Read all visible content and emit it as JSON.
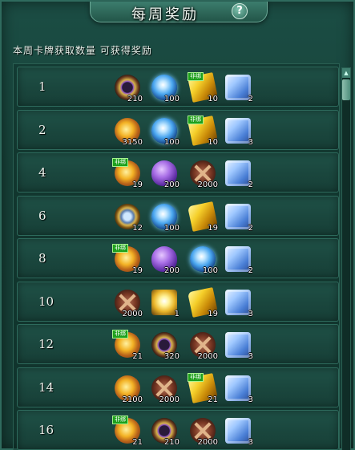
{
  "header": {
    "title": "每周奖励",
    "help_label": "?"
  },
  "subtitle": "本周卡牌获取数量  可获得奖励",
  "rows": [
    {
      "level": "1",
      "items": [
        {
          "name": "purple-ring-icon",
          "cls": "ico-ring",
          "qty": "210",
          "tag": ""
        },
        {
          "name": "blue-orb-icon",
          "cls": "ico-orb",
          "qty": "100",
          "tag": ""
        },
        {
          "name": "gold-crystal-icon",
          "cls": "ico-crystal",
          "qty": "10",
          "tag": "非绑"
        },
        {
          "name": "gift-box-icon",
          "cls": "ico-gift",
          "qty": "2",
          "tag": ""
        }
      ]
    },
    {
      "level": "2",
      "items": [
        {
          "name": "gold-token-icon",
          "cls": "ico-token",
          "qty": "3150",
          "tag": ""
        },
        {
          "name": "blue-orb-icon",
          "cls": "ico-orb",
          "qty": "100",
          "tag": ""
        },
        {
          "name": "gold-crystal-icon",
          "cls": "ico-crystal",
          "qty": "10",
          "tag": "非绑"
        },
        {
          "name": "gift-box-icon",
          "cls": "ico-gift",
          "qty": "3",
          "tag": ""
        }
      ]
    },
    {
      "level": "4",
      "items": [
        {
          "name": "gold-token-icon",
          "cls": "ico-token",
          "qty": "19",
          "tag": "非绑"
        },
        {
          "name": "purple-gem-icon",
          "cls": "ico-gem",
          "qty": "200",
          "tag": ""
        },
        {
          "name": "crossed-swords-icon",
          "cls": "ico-sword",
          "qty": "2000",
          "tag": ""
        },
        {
          "name": "gift-box-icon",
          "cls": "ico-gift",
          "qty": "2",
          "tag": ""
        }
      ]
    },
    {
      "level": "6",
      "items": [
        {
          "name": "compass-icon",
          "cls": "ico-compass",
          "qty": "12",
          "tag": ""
        },
        {
          "name": "blue-orb-icon",
          "cls": "ico-orb",
          "qty": "100",
          "tag": ""
        },
        {
          "name": "gold-crystal-icon",
          "cls": "ico-crystal",
          "qty": "19",
          "tag": ""
        },
        {
          "name": "gift-box-icon",
          "cls": "ico-gift",
          "qty": "2",
          "tag": ""
        }
      ]
    },
    {
      "level": "8",
      "items": [
        {
          "name": "gold-token-icon",
          "cls": "ico-token",
          "qty": "19",
          "tag": "非绑"
        },
        {
          "name": "purple-gem-icon",
          "cls": "ico-gem",
          "qty": "200",
          "tag": ""
        },
        {
          "name": "blue-orb-icon",
          "cls": "ico-orb",
          "qty": "100",
          "tag": ""
        },
        {
          "name": "gift-box-icon",
          "cls": "ico-gift",
          "qty": "2",
          "tag": ""
        }
      ]
    },
    {
      "level": "10",
      "items": [
        {
          "name": "crossed-swords-icon",
          "cls": "ico-sword",
          "qty": "2000",
          "tag": ""
        },
        {
          "name": "sun-book-icon",
          "cls": "ico-sunbook",
          "qty": "1",
          "tag": ""
        },
        {
          "name": "gold-crystal-icon",
          "cls": "ico-crystal",
          "qty": "19",
          "tag": ""
        },
        {
          "name": "gift-box-icon",
          "cls": "ico-gift",
          "qty": "3",
          "tag": ""
        }
      ]
    },
    {
      "level": "12",
      "items": [
        {
          "name": "gold-token-icon",
          "cls": "ico-token",
          "qty": "21",
          "tag": "非绑"
        },
        {
          "name": "purple-ring-icon",
          "cls": "ico-ring",
          "qty": "320",
          "tag": ""
        },
        {
          "name": "crossed-swords-icon",
          "cls": "ico-sword",
          "qty": "2000",
          "tag": ""
        },
        {
          "name": "gift-box-icon",
          "cls": "ico-gift",
          "qty": "3",
          "tag": ""
        }
      ]
    },
    {
      "level": "14",
      "items": [
        {
          "name": "gold-token-icon",
          "cls": "ico-token",
          "qty": "2100",
          "tag": ""
        },
        {
          "name": "crossed-swords-icon",
          "cls": "ico-sword",
          "qty": "2000",
          "tag": ""
        },
        {
          "name": "gold-crystal-icon",
          "cls": "ico-crystal",
          "qty": "21",
          "tag": "非绑"
        },
        {
          "name": "gift-box-icon",
          "cls": "ico-gift",
          "qty": "3",
          "tag": ""
        }
      ]
    },
    {
      "level": "16",
      "items": [
        {
          "name": "gold-token-icon",
          "cls": "ico-token",
          "qty": "21",
          "tag": "非绑"
        },
        {
          "name": "purple-ring-icon",
          "cls": "ico-ring",
          "qty": "210",
          "tag": ""
        },
        {
          "name": "crossed-swords-icon",
          "cls": "ico-sword",
          "qty": "2000",
          "tag": ""
        },
        {
          "name": "gift-box-icon",
          "cls": "ico-gift",
          "qty": "3",
          "tag": ""
        }
      ]
    }
  ]
}
